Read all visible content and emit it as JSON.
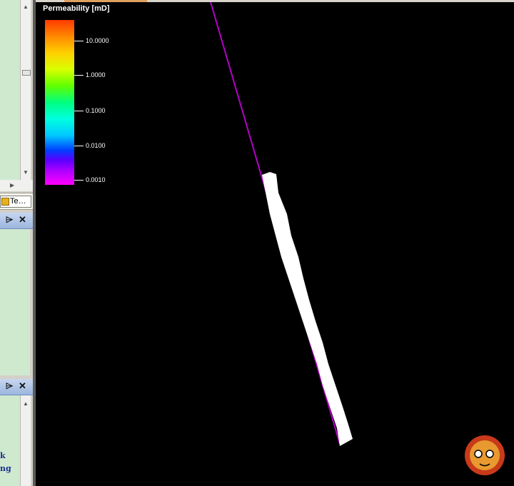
{
  "sidebar": {
    "tab_label": "Te…",
    "pane_header_pin": "⌲",
    "pane_header_close": "✕",
    "text_fragments": [
      "k",
      "ng"
    ]
  },
  "legend": {
    "title": "Permeability [mD]",
    "ticks": [
      "10.0000",
      "1.0000",
      "0.1000",
      "0.0100",
      "0.0010"
    ]
  },
  "colors": {
    "background": "#000000",
    "well_trajectory": "#b400c8",
    "log_track": "#ffffff"
  },
  "icons": {
    "tab_icon": "folder-icon",
    "mascot": "sun-mascot-icon"
  }
}
